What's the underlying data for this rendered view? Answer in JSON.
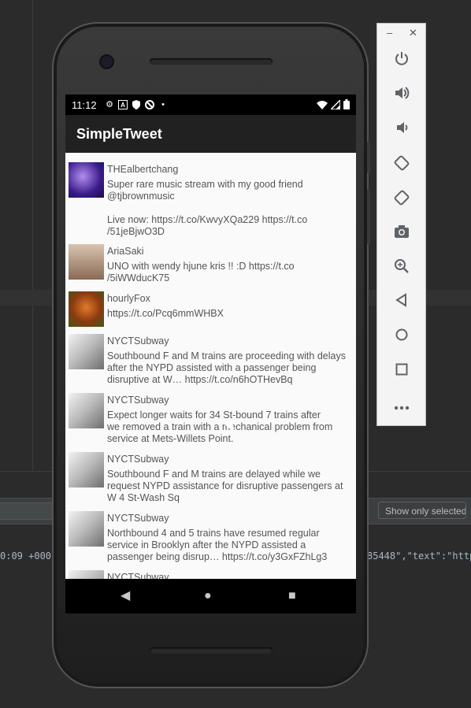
{
  "app": {
    "title": "SimpleTweet"
  },
  "status_bar": {
    "time": "11:12",
    "icons": [
      "gear-icon",
      "a-icon",
      "shield-icon",
      "no-icon",
      "dot-icon"
    ],
    "right_icons": [
      "wifi-icon",
      "signal-icon",
      "battery-icon"
    ]
  },
  "tweets": [
    {
      "handle": "THEalbertchang",
      "text": "Super rare music stream with my good friend\n@tjbrownmusic\n\nLive now: https://t.co/KwvyXQa229 https://t.co\n/51jeBjwO3D"
    },
    {
      "handle": "AriaSaki",
      "text": "UNO with wendy hjune kris !! :D https://t.co\n/5iWWducK75"
    },
    {
      "handle": "hourlyFox",
      "text": "https://t.co/Pcq6mmWHBX"
    },
    {
      "handle": "NYCTSubway",
      "text": "Southbound F and M trains are proceeding with delays\nafter the NYPD assisted with a passenger being\ndisruptive at W… https://t.co/n6hOTHevBq"
    },
    {
      "handle": "NYCTSubway",
      "text": "Expect longer waits for 34 St-bound 7 trains after\nwe removed a train with a mechanical problem from\nservice at Mets-Willets Point."
    },
    {
      "handle": "NYCTSubway",
      "text": "Southbound F and M trains are delayed while we\nrequest NYPD assistance for disruptive passengers at\nW 4 St-Wash Sq"
    },
    {
      "handle": "NYCTSubway",
      "text": "Northbound 4 and 5 trains have resumed regular\nservice in Brooklyn after the NYPD assisted a\npassenger being disrup… https://t.co/y3GxFZhLg3"
    },
    {
      "handle": "NYCTSubway",
      "text": ""
    }
  ],
  "ide": {
    "show_only_label": "Show only selected a",
    "log_left": "0:09 +000",
    "log_right": "85448\",\"text\":\"http"
  },
  "emulator_panel": {
    "window_controls": [
      "minimize-icon",
      "close-icon"
    ],
    "minimize": "–",
    "close": "✕",
    "buttons": [
      "power-icon",
      "volume-up-icon",
      "volume-down-icon",
      "rotate-left-icon",
      "rotate-right-icon",
      "camera-icon",
      "zoom-icon",
      "back-icon",
      "home-icon",
      "overview-icon",
      "more-icon"
    ]
  },
  "colors": {
    "appbar": "#212121",
    "screen_bg": "#fafafa",
    "ide_bg": "#2b2b2b"
  }
}
